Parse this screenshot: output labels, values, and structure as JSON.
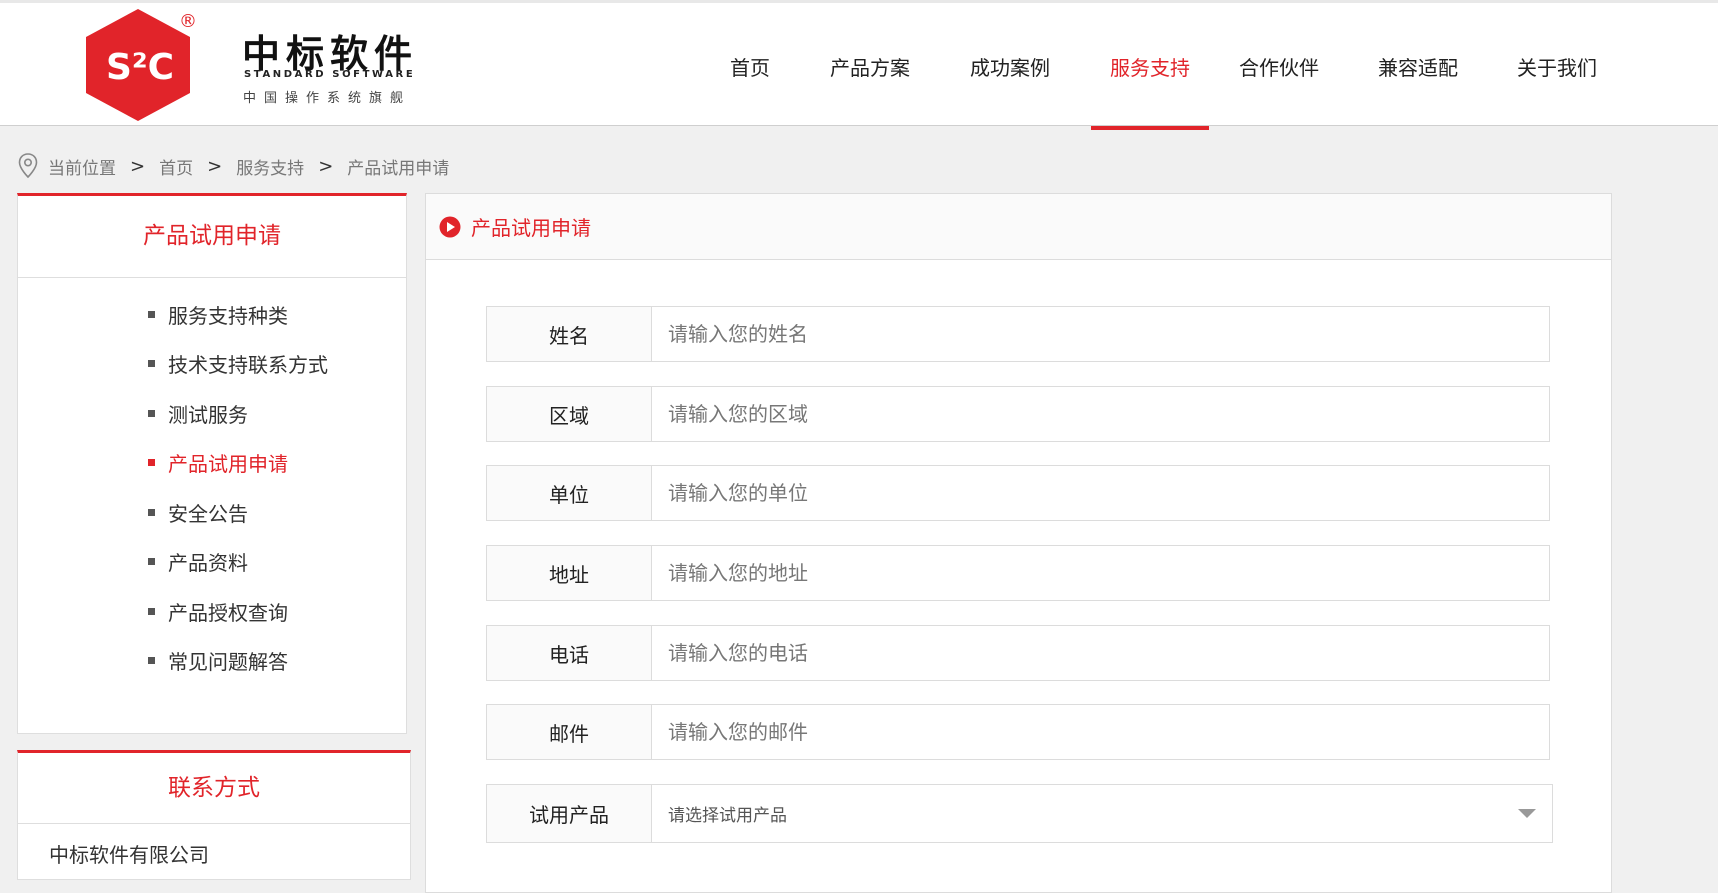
{
  "brand": {
    "badge_text": "S²C",
    "registered": "®",
    "name_cn": "中标软件",
    "name_en": "STANDARD SOFTWARE",
    "slogan": "中国操作系统旗舰",
    "colors": {
      "accent": "#e1242a"
    }
  },
  "nav": {
    "items": [
      {
        "label": "首页"
      },
      {
        "label": "产品方案"
      },
      {
        "label": "成功案例"
      },
      {
        "label": "服务支持",
        "active": true
      },
      {
        "label": "合作伙伴"
      },
      {
        "label": "兼容适配"
      },
      {
        "label": "关于我们"
      }
    ]
  },
  "breadcrumb": {
    "prefix": "当前位置",
    "items": [
      "首页",
      "服务支持",
      "产品试用申请"
    ],
    "separator": ">"
  },
  "sidebar": {
    "title": "产品试用申请",
    "items": [
      {
        "label": "服务支持种类"
      },
      {
        "label": "技术支持联系方式"
      },
      {
        "label": "测试服务"
      },
      {
        "label": "产品试用申请",
        "active": true
      },
      {
        "label": "安全公告"
      },
      {
        "label": "产品资料"
      },
      {
        "label": "产品授权查询"
      },
      {
        "label": "常见问题解答"
      }
    ]
  },
  "contact": {
    "title": "联系方式",
    "company": "中标软件有限公司"
  },
  "main": {
    "title": "产品试用申请",
    "form": {
      "fields": [
        {
          "label": "姓名",
          "placeholder": "请输入您的姓名"
        },
        {
          "label": "区域",
          "placeholder": "请输入您的区域"
        },
        {
          "label": "单位",
          "placeholder": "请输入您的单位"
        },
        {
          "label": "地址",
          "placeholder": "请输入您的地址"
        },
        {
          "label": "电话",
          "placeholder": "请输入您的电话"
        },
        {
          "label": "邮件",
          "placeholder": "请输入您的邮件"
        }
      ],
      "product_select": {
        "label": "试用产品",
        "placeholder": "请选择试用产品"
      }
    }
  }
}
